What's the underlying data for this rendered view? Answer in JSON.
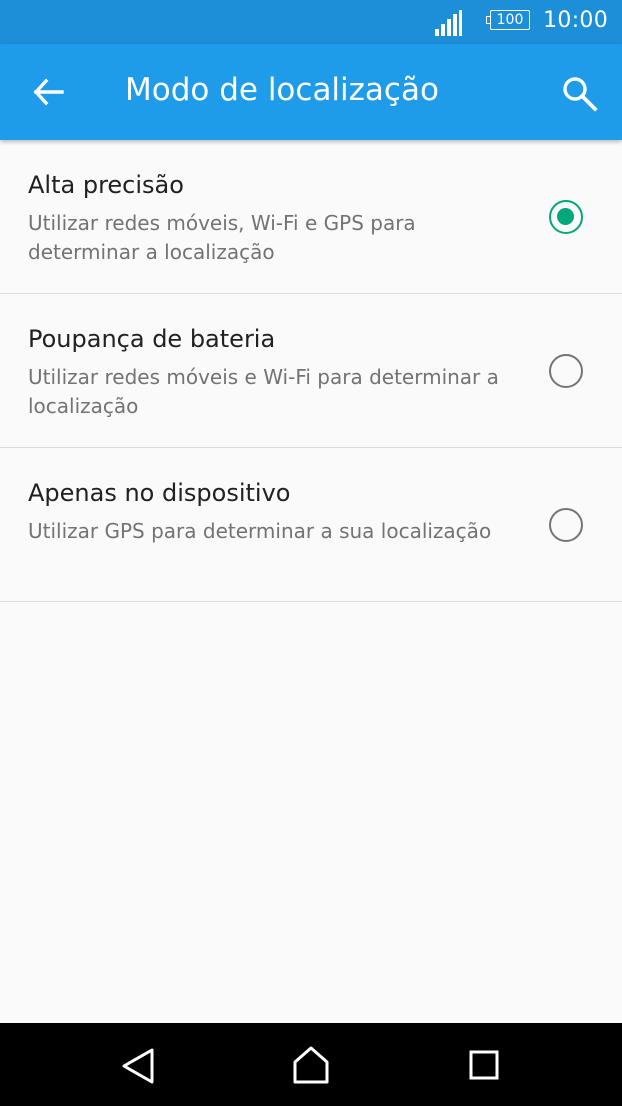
{
  "status_bar": {
    "time": "10:00",
    "battery_level": "100",
    "icons": [
      "signal-icon",
      "battery-icon"
    ]
  },
  "app_bar": {
    "title": "Modo de localização",
    "back_icon": "arrow-left-icon",
    "search_icon": "search-icon",
    "color": "#1e9cea"
  },
  "options": [
    {
      "title": "Alta precisão",
      "description": "Utilizar redes móveis, Wi-Fi e GPS para determinar a localização",
      "selected": true
    },
    {
      "title": "Poupança de bateria",
      "description": "Utilizar redes móveis e Wi-Fi para determinar a localização",
      "selected": false
    },
    {
      "title": "Apenas no dispositivo",
      "description": "Utilizar GPS para determinar a sua localização",
      "selected": false
    }
  ],
  "accent_color": "#00a87a",
  "nav_bar": {
    "icons": [
      "nav-back-icon",
      "nav-home-icon",
      "nav-recent-apps-icon"
    ]
  }
}
